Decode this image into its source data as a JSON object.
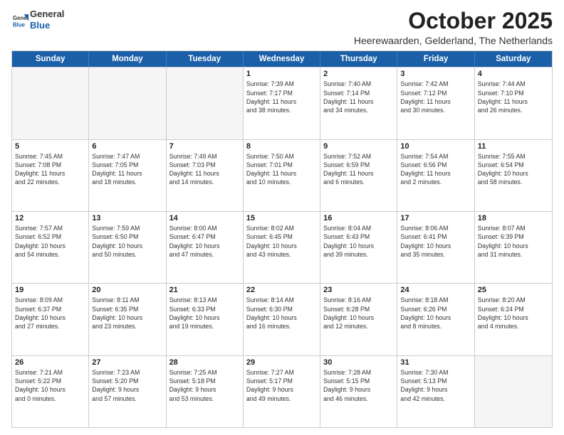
{
  "logo": {
    "general": "General",
    "blue": "Blue"
  },
  "title": "October 2025",
  "subtitle": "Heerewaarden, Gelderland, The Netherlands",
  "header_days": [
    "Sunday",
    "Monday",
    "Tuesday",
    "Wednesday",
    "Thursday",
    "Friday",
    "Saturday"
  ],
  "weeks": [
    [
      {
        "day": "",
        "info": ""
      },
      {
        "day": "",
        "info": ""
      },
      {
        "day": "",
        "info": ""
      },
      {
        "day": "1",
        "info": "Sunrise: 7:39 AM\nSunset: 7:17 PM\nDaylight: 11 hours\nand 38 minutes."
      },
      {
        "day": "2",
        "info": "Sunrise: 7:40 AM\nSunset: 7:14 PM\nDaylight: 11 hours\nand 34 minutes."
      },
      {
        "day": "3",
        "info": "Sunrise: 7:42 AM\nSunset: 7:12 PM\nDaylight: 11 hours\nand 30 minutes."
      },
      {
        "day": "4",
        "info": "Sunrise: 7:44 AM\nSunset: 7:10 PM\nDaylight: 11 hours\nand 26 minutes."
      }
    ],
    [
      {
        "day": "5",
        "info": "Sunrise: 7:45 AM\nSunset: 7:08 PM\nDaylight: 11 hours\nand 22 minutes."
      },
      {
        "day": "6",
        "info": "Sunrise: 7:47 AM\nSunset: 7:05 PM\nDaylight: 11 hours\nand 18 minutes."
      },
      {
        "day": "7",
        "info": "Sunrise: 7:49 AM\nSunset: 7:03 PM\nDaylight: 11 hours\nand 14 minutes."
      },
      {
        "day": "8",
        "info": "Sunrise: 7:50 AM\nSunset: 7:01 PM\nDaylight: 11 hours\nand 10 minutes."
      },
      {
        "day": "9",
        "info": "Sunrise: 7:52 AM\nSunset: 6:59 PM\nDaylight: 11 hours\nand 6 minutes."
      },
      {
        "day": "10",
        "info": "Sunrise: 7:54 AM\nSunset: 6:56 PM\nDaylight: 11 hours\nand 2 minutes."
      },
      {
        "day": "11",
        "info": "Sunrise: 7:55 AM\nSunset: 6:54 PM\nDaylight: 10 hours\nand 58 minutes."
      }
    ],
    [
      {
        "day": "12",
        "info": "Sunrise: 7:57 AM\nSunset: 6:52 PM\nDaylight: 10 hours\nand 54 minutes."
      },
      {
        "day": "13",
        "info": "Sunrise: 7:59 AM\nSunset: 6:50 PM\nDaylight: 10 hours\nand 50 minutes."
      },
      {
        "day": "14",
        "info": "Sunrise: 8:00 AM\nSunset: 6:47 PM\nDaylight: 10 hours\nand 47 minutes."
      },
      {
        "day": "15",
        "info": "Sunrise: 8:02 AM\nSunset: 6:45 PM\nDaylight: 10 hours\nand 43 minutes."
      },
      {
        "day": "16",
        "info": "Sunrise: 8:04 AM\nSunset: 6:43 PM\nDaylight: 10 hours\nand 39 minutes."
      },
      {
        "day": "17",
        "info": "Sunrise: 8:06 AM\nSunset: 6:41 PM\nDaylight: 10 hours\nand 35 minutes."
      },
      {
        "day": "18",
        "info": "Sunrise: 8:07 AM\nSunset: 6:39 PM\nDaylight: 10 hours\nand 31 minutes."
      }
    ],
    [
      {
        "day": "19",
        "info": "Sunrise: 8:09 AM\nSunset: 6:37 PM\nDaylight: 10 hours\nand 27 minutes."
      },
      {
        "day": "20",
        "info": "Sunrise: 8:11 AM\nSunset: 6:35 PM\nDaylight: 10 hours\nand 23 minutes."
      },
      {
        "day": "21",
        "info": "Sunrise: 8:13 AM\nSunset: 6:33 PM\nDaylight: 10 hours\nand 19 minutes."
      },
      {
        "day": "22",
        "info": "Sunrise: 8:14 AM\nSunset: 6:30 PM\nDaylight: 10 hours\nand 16 minutes."
      },
      {
        "day": "23",
        "info": "Sunrise: 8:16 AM\nSunset: 6:28 PM\nDaylight: 10 hours\nand 12 minutes."
      },
      {
        "day": "24",
        "info": "Sunrise: 8:18 AM\nSunset: 6:26 PM\nDaylight: 10 hours\nand 8 minutes."
      },
      {
        "day": "25",
        "info": "Sunrise: 8:20 AM\nSunset: 6:24 PM\nDaylight: 10 hours\nand 4 minutes."
      }
    ],
    [
      {
        "day": "26",
        "info": "Sunrise: 7:21 AM\nSunset: 5:22 PM\nDaylight: 10 hours\nand 0 minutes."
      },
      {
        "day": "27",
        "info": "Sunrise: 7:23 AM\nSunset: 5:20 PM\nDaylight: 9 hours\nand 57 minutes."
      },
      {
        "day": "28",
        "info": "Sunrise: 7:25 AM\nSunset: 5:18 PM\nDaylight: 9 hours\nand 53 minutes."
      },
      {
        "day": "29",
        "info": "Sunrise: 7:27 AM\nSunset: 5:17 PM\nDaylight: 9 hours\nand 49 minutes."
      },
      {
        "day": "30",
        "info": "Sunrise: 7:28 AM\nSunset: 5:15 PM\nDaylight: 9 hours\nand 46 minutes."
      },
      {
        "day": "31",
        "info": "Sunrise: 7:30 AM\nSunset: 5:13 PM\nDaylight: 9 hours\nand 42 minutes."
      },
      {
        "day": "",
        "info": ""
      }
    ]
  ]
}
